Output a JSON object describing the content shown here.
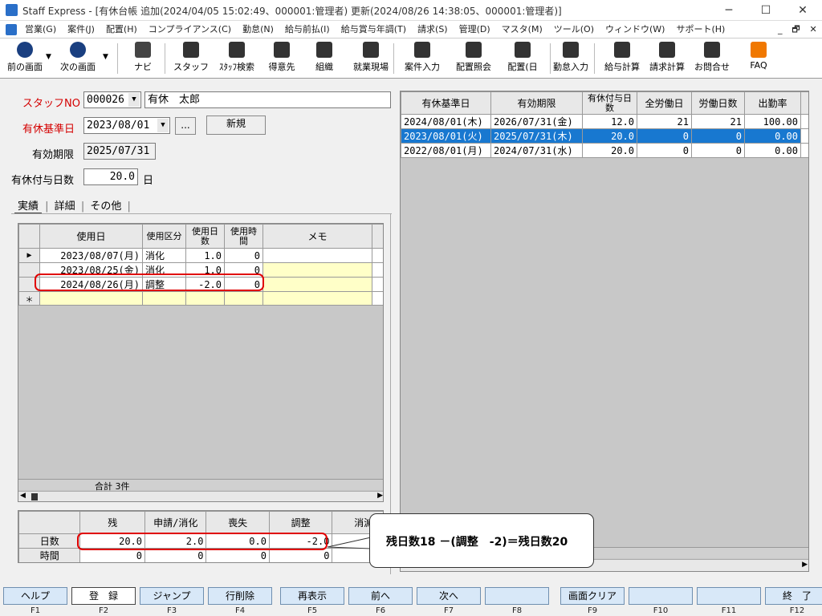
{
  "window": {
    "title": "Staff Express - [有休台帳  追加(2024/04/05 15:02:49、000001:管理者)  更新(2024/08/26 14:38:05、000001:管理者)]",
    "minimize": "─",
    "maximize": "☐",
    "close": "✕"
  },
  "menu": [
    "営業(G)",
    "案件(J)",
    "配置(H)",
    "コンプライアンス(C)",
    "勤怠(N)",
    "給与前払(I)",
    "給与賞与年調(T)",
    "請求(S)",
    "管理(D)",
    "マスタ(M)",
    "ツール(O)",
    "ウィンドウ(W)",
    "サポート(H)"
  ],
  "mdi_controls": [
    "_",
    "🗗",
    "✕"
  ],
  "toolbar": {
    "prev": "前の画面",
    "next": "次の画面",
    "items": [
      "ナビ",
      "スタッフ",
      "ｽﾀｯﾌ検索",
      "得意先",
      "組織",
      "就業現場",
      "案件入力",
      "配置照会",
      "配置(日",
      "勤怠入力",
      "給与計算",
      "請求計算",
      "お問合せ",
      "FAQ"
    ]
  },
  "form": {
    "staff_no_label": "スタッフNO",
    "staff_no": "000026",
    "staff_name": "有休　太郎",
    "base_date_label": "有休基準日",
    "base_date": "2023/08/01",
    "ellipsis": "...",
    "new_button": "新規",
    "expiry_label": "有効期限",
    "expiry": "2025/07/31",
    "grant_days_label": "有休付与日数",
    "grant_days": "20.0",
    "grant_days_unit": "日"
  },
  "tabs": [
    "実績",
    "詳細",
    "その他"
  ],
  "usage_grid": {
    "headers": [
      "使用日",
      "使用区分",
      "使用日数",
      "使用時間",
      "メモ"
    ],
    "rows": [
      {
        "date": "2023/08/07(月)",
        "kind": "消化",
        "days": "1.0",
        "time": "0",
        "memo": ""
      },
      {
        "date": "2023/08/25(金)",
        "kind": "消化",
        "days": "1.0",
        "time": "0",
        "memo": ""
      },
      {
        "date": "2024/08/26(月)",
        "kind": "調整",
        "days": "-2.0",
        "time": "0",
        "memo": ""
      }
    ],
    "new_row_marker": "＊",
    "footer": "合計 3件"
  },
  "summary": {
    "headers": [
      "残",
      "申請/消化",
      "喪失",
      "調整",
      "消滅"
    ],
    "rows": [
      {
        "label": "日数",
        "values": [
          "20.0",
          "2.0",
          "0.0",
          "-2.0",
          ""
        ]
      },
      {
        "label": "時間",
        "values": [
          "0",
          "0",
          "0",
          "0",
          ""
        ]
      }
    ]
  },
  "history_grid": {
    "headers": [
      "有休基準日",
      "有効期限",
      "有休付与日数",
      "全労働日",
      "労働日数",
      "出勤率"
    ],
    "rows": [
      {
        "base": "2024/08/01(木)",
        "expiry": "2026/07/31(金)",
        "grant": "12.0",
        "all_days": "21",
        "work_days": "21",
        "rate": "100.00",
        "selected": false
      },
      {
        "base": "2023/08/01(火)",
        "expiry": "2025/07/31(木)",
        "grant": "20.0",
        "all_days": "0",
        "work_days": "0",
        "rate": "0.00",
        "selected": true
      },
      {
        "base": "2022/08/01(月)",
        "expiry": "2024/07/31(水)",
        "grant": "20.0",
        "all_days": "0",
        "work_days": "0",
        "rate": "0.00",
        "selected": false
      }
    ]
  },
  "callout": "残日数18 －(調整　-2)＝残日数20",
  "fkeys": [
    {
      "label": "ヘルプ",
      "key": "F1"
    },
    {
      "label": "登　録",
      "key": "F2"
    },
    {
      "label": "ジャンプ",
      "key": "F3"
    },
    {
      "label": "行削除",
      "key": "F4"
    },
    {
      "label": "再表示",
      "key": "F5"
    },
    {
      "label": "前へ",
      "key": "F6"
    },
    {
      "label": "次へ",
      "key": "F7"
    },
    {
      "label": "",
      "key": "F8"
    },
    {
      "label": "画面クリア",
      "key": "F9"
    },
    {
      "label": "",
      "key": "F10"
    },
    {
      "label": "",
      "key": "F11"
    },
    {
      "label": "終　了",
      "key": "F12"
    }
  ],
  "colors": {
    "selection": "#1878d0",
    "accent_red": "#e00000"
  }
}
